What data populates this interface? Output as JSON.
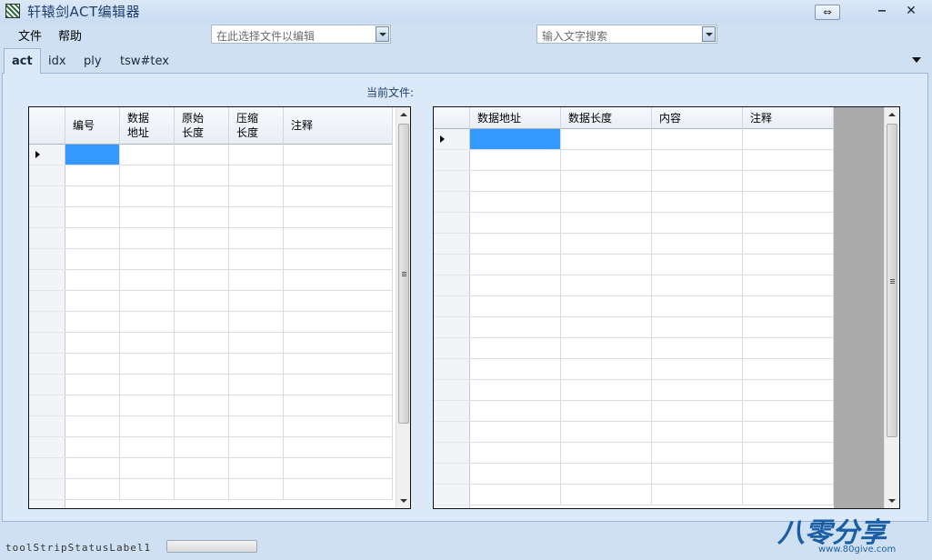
{
  "window": {
    "title": "轩辕剑ACT编辑器"
  },
  "menu": {
    "file": "文件",
    "help": "帮助"
  },
  "toolbar": {
    "file_select_placeholder": "在此选择文件以编辑",
    "search_placeholder": "输入文字搜索"
  },
  "tabs": {
    "act": "act",
    "idx": "idx",
    "ply": "ply",
    "tsw": "tsw#tex"
  },
  "main": {
    "current_file_label": "当前文件:"
  },
  "left_grid": {
    "columns": [
      {
        "line1": "编号",
        "line2": ""
      },
      {
        "line1": "数据",
        "line2": "地址"
      },
      {
        "line1": "原始",
        "line2": "长度"
      },
      {
        "line1": "压缩",
        "line2": "长度"
      },
      {
        "line1": "注释",
        "line2": ""
      }
    ],
    "row_count": 17
  },
  "right_grid": {
    "columns": [
      "数据地址",
      "数据长度",
      "内容",
      "注释"
    ],
    "row_count": 18
  },
  "status": {
    "label": "toolStripStatusLabel1"
  },
  "watermark": {
    "logo_text": "八零分享",
    "url": "www.80give.com"
  },
  "colors": {
    "selection": "#3399ff",
    "background": "#cfe0f3",
    "tab_page": "#dce9f8"
  }
}
